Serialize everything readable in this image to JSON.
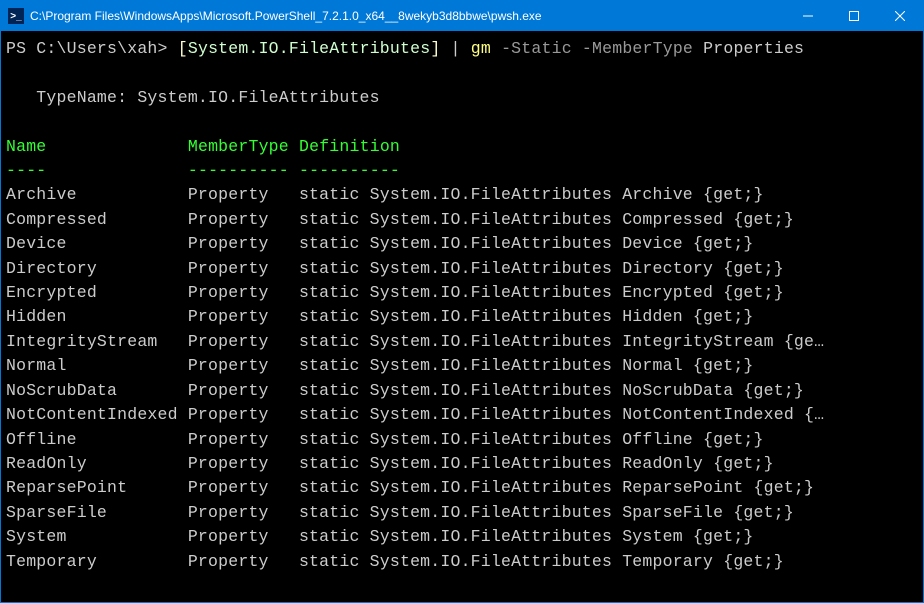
{
  "titlebar": {
    "icon_glyph": ">_",
    "text": "C:\\Program Files\\WindowsApps\\Microsoft.PowerShell_7.2.1.0_x64__8wekyb3d8bbwe\\pwsh.exe"
  },
  "prompt": {
    "prefix": "PS C:\\Users\\xah>",
    "bracket_open": "[",
    "type": "System.IO.FileAttributes",
    "bracket_close": "]",
    "pipe": "|",
    "cmd": "gm",
    "param1": "-Static",
    "param2": "-MemberType",
    "arg": "Properties"
  },
  "typename_line": "   TypeName: System.IO.FileAttributes",
  "headers": {
    "name": "Name",
    "membertype": "MemberType",
    "definition": "Definition"
  },
  "header_underlines": {
    "name": "----",
    "membertype": "----------",
    "definition": "----------"
  },
  "rows": [
    {
      "name": "Archive          ",
      "membertype": "Property  ",
      "definition": "static System.IO.FileAttributes Archive {get;}"
    },
    {
      "name": "Compressed       ",
      "membertype": "Property  ",
      "definition": "static System.IO.FileAttributes Compressed {get;}"
    },
    {
      "name": "Device           ",
      "membertype": "Property  ",
      "definition": "static System.IO.FileAttributes Device {get;}"
    },
    {
      "name": "Directory        ",
      "membertype": "Property  ",
      "definition": "static System.IO.FileAttributes Directory {get;}"
    },
    {
      "name": "Encrypted        ",
      "membertype": "Property  ",
      "definition": "static System.IO.FileAttributes Encrypted {get;}"
    },
    {
      "name": "Hidden           ",
      "membertype": "Property  ",
      "definition": "static System.IO.FileAttributes Hidden {get;}"
    },
    {
      "name": "IntegrityStream  ",
      "membertype": "Property  ",
      "definition": "static System.IO.FileAttributes IntegrityStream {ge…"
    },
    {
      "name": "Normal           ",
      "membertype": "Property  ",
      "definition": "static System.IO.FileAttributes Normal {get;}"
    },
    {
      "name": "NoScrubData      ",
      "membertype": "Property  ",
      "definition": "static System.IO.FileAttributes NoScrubData {get;}"
    },
    {
      "name": "NotContentIndexed",
      "membertype": "Property  ",
      "definition": "static System.IO.FileAttributes NotContentIndexed {…"
    },
    {
      "name": "Offline          ",
      "membertype": "Property  ",
      "definition": "static System.IO.FileAttributes Offline {get;}"
    },
    {
      "name": "ReadOnly         ",
      "membertype": "Property  ",
      "definition": "static System.IO.FileAttributes ReadOnly {get;}"
    },
    {
      "name": "ReparsePoint     ",
      "membertype": "Property  ",
      "definition": "static System.IO.FileAttributes ReparsePoint {get;}"
    },
    {
      "name": "SparseFile       ",
      "membertype": "Property  ",
      "definition": "static System.IO.FileAttributes SparseFile {get;}"
    },
    {
      "name": "System           ",
      "membertype": "Property  ",
      "definition": "static System.IO.FileAttributes System {get;}"
    },
    {
      "name": "Temporary        ",
      "membertype": "Property  ",
      "definition": "static System.IO.FileAttributes Temporary {get;}"
    }
  ]
}
